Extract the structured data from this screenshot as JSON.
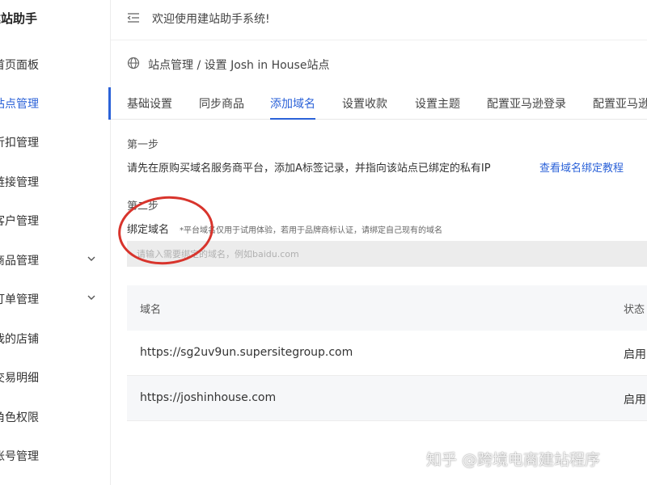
{
  "sidebar": {
    "brand": "建站助手",
    "items": [
      {
        "label": "首页面板"
      },
      {
        "label": "站点管理"
      },
      {
        "label": "折扣管理"
      },
      {
        "label": "链接管理"
      },
      {
        "label": "客户管理"
      },
      {
        "label": "商品管理"
      },
      {
        "label": "订单管理"
      },
      {
        "label": "我的店铺"
      },
      {
        "label": "交易明细"
      },
      {
        "label": "角色权限"
      },
      {
        "label": "账号管理"
      }
    ]
  },
  "header": {
    "welcome": "欢迎使用建站助手系统!"
  },
  "breadcrumb": {
    "text": "站点管理 / 设置 Josh in House站点"
  },
  "tabs": [
    {
      "label": "基础设置"
    },
    {
      "label": "同步商品"
    },
    {
      "label": "添加域名"
    },
    {
      "label": "设置收款"
    },
    {
      "label": "设置主题"
    },
    {
      "label": "配置亚马逊登录"
    },
    {
      "label": "配置亚马逊"
    }
  ],
  "step1": {
    "title": "第一步",
    "desc": "请先在原购买域名服务商平台，添加A标签记录，并指向该站点已绑定的私有IP",
    "link": "查看域名绑定教程"
  },
  "step2": {
    "title": "第二步",
    "bind_label": "绑定域名",
    "note": "*平台域名仅用于试用体验，若用于品牌商标认证，请绑定自己现有的域名",
    "placeholder": "请输入需要绑定的域名，例如baidu.com"
  },
  "table": {
    "headers": {
      "domain": "域名",
      "status": "状态"
    },
    "rows": [
      {
        "domain": "https://sg2uv9un.supersitegroup.com",
        "status": "启用"
      },
      {
        "domain": "https://joshinhouse.com",
        "status": "启用"
      }
    ]
  },
  "watermark": "知乎 @跨境电商建站程序",
  "colors": {
    "accent": "#2b62d8",
    "annotation": "#d8342c"
  }
}
